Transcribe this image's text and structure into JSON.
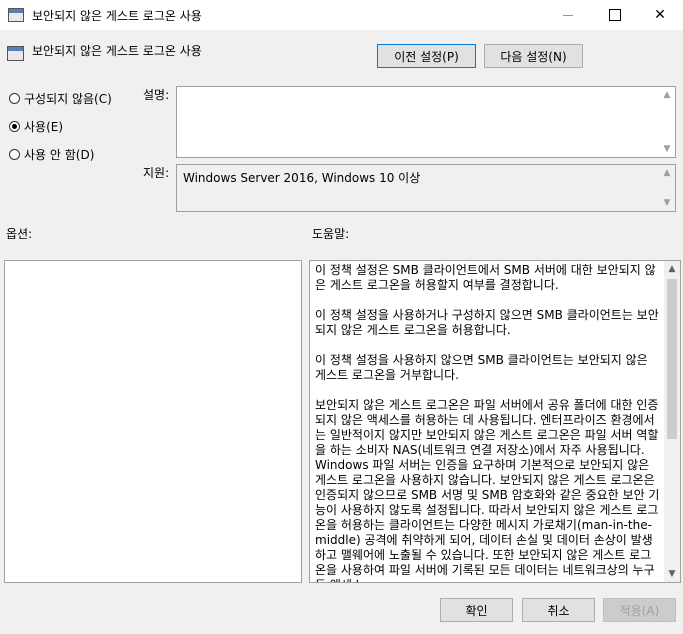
{
  "window": {
    "title": "보안되지 않은 게스트 로그온 사용",
    "controls": {
      "minimize": "—",
      "close": "✕"
    }
  },
  "header": {
    "title": "보안되지 않은 게스트 로그온 사용"
  },
  "nav": {
    "prev_label": "이전 설정(P)",
    "next_label": "다음 설정(N)"
  },
  "state": {
    "options": [
      {
        "label": "구성되지 않음(C)",
        "selected": false
      },
      {
        "label": "사용(E)",
        "selected": true
      },
      {
        "label": "사용 안 함(D)",
        "selected": false
      }
    ]
  },
  "comment": {
    "label": "설명:",
    "value": ""
  },
  "supported": {
    "label": "지원:",
    "value": "Windows Server 2016, Windows 10 이상"
  },
  "options_panel": {
    "label": "옵션:"
  },
  "help": {
    "label": "도움말:",
    "paragraphs": [
      "이 정책 설정은 SMB 클라이언트에서 SMB 서버에 대한 보안되지 않은 게스트 로그온을 허용할지 여부를 결정합니다.",
      "이 정책 설정을 사용하거나 구성하지 않으면 SMB 클라이언트는 보안되지 않은 게스트 로그온을 허용합니다.",
      "이 정책 설정을 사용하지 않으면 SMB 클라이언트는 보안되지 않은 게스트 로그온을 거부합니다.",
      "보안되지 않은 게스트 로그온은 파일 서버에서 공유 폴더에 대한 인증되지 않은 액세스를 허용하는 데 사용됩니다. 엔터프라이즈 환경에서는 일반적이지 않지만 보안되지 않은 게스트 로그온은 파일 서버 역할을 하는 소비자 NAS(네트워크 연결 저장소)에서 자주 사용됩니다. Windows 파일 서버는 인증을 요구하며 기본적으로 보안되지 않은 게스트 로그온을 사용하지 않습니다. 보안되지 않은 게스트 로그온은 인증되지 않으므로 SMB 서명 및 SMB 암호화와 같은 중요한 보안 기능이 사용하지 않도록 설정됩니다. 따라서 보안되지 않은 게스트 로그온을 허용하는 클라이언트는 다양한 메시지 가로채기(man-in-the-middle) 공격에 취약하게 되어, 데이터 손실 및 데이터 손상이 발생하고 맬웨어에 노출될 수 있습니다. 또한 보안되지 않은 게스트 로그온을 사용하여 파일 서버에 기록된 모든 데이터는 네트워크상의 누구든 액세스"
    ]
  },
  "footer": {
    "ok_label": "확인",
    "cancel_label": "취소",
    "apply_label": "적용(A)"
  }
}
